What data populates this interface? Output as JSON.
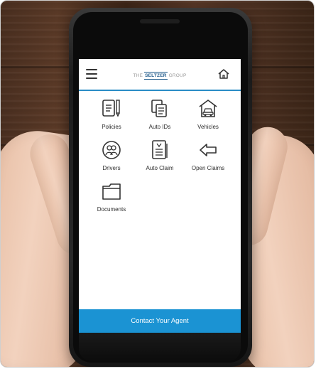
{
  "app": {
    "logo": {
      "prefix": "THE",
      "brand": "SELTZER",
      "suffix": "GROUP"
    },
    "icons": {
      "menu": "hamburger-icon",
      "home": "home-icon"
    },
    "tiles": [
      {
        "label": "Policies",
        "icon": "policy-document-icon"
      },
      {
        "label": "Auto IDs",
        "icon": "id-cards-icon"
      },
      {
        "label": "Vehicles",
        "icon": "garage-car-icon"
      },
      {
        "label": "Drivers",
        "icon": "drivers-icon"
      },
      {
        "label": "Auto Claim",
        "icon": "claim-form-icon"
      },
      {
        "label": "Open Claims",
        "icon": "arrow-left-icon"
      },
      {
        "label": "Documents",
        "icon": "folder-icon"
      }
    ],
    "contact_button": "Contact Your Agent",
    "colors": {
      "accent": "#2a8dc6",
      "contact_bar": "#1b93d3"
    }
  }
}
